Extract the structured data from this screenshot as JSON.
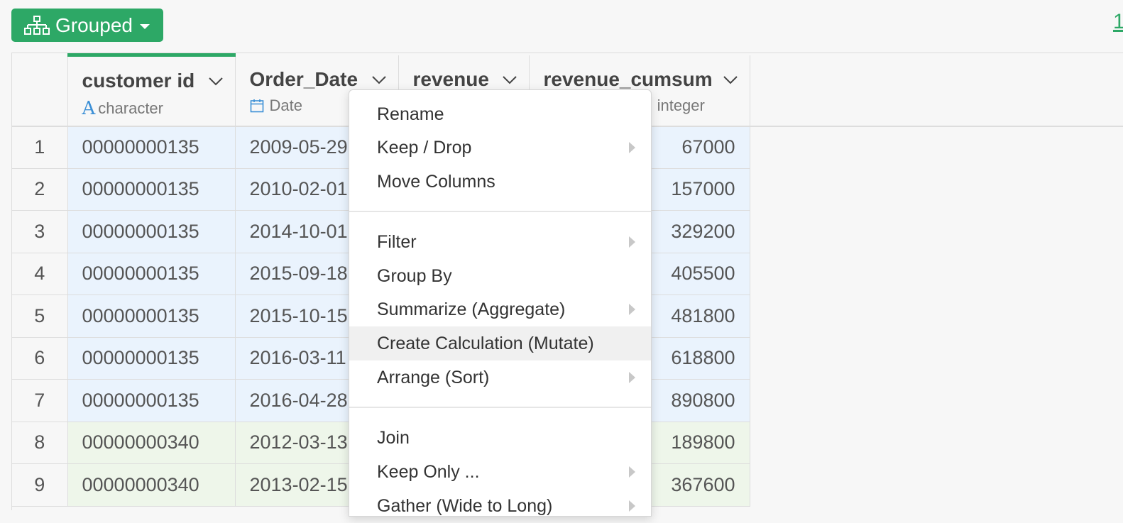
{
  "toolbar": {
    "grouped_label": "Grouped",
    "corner_link": "1"
  },
  "columns": [
    {
      "title": "customer id",
      "type": "character",
      "type_icon": "character-type-icon"
    },
    {
      "title": "Order_Date",
      "type": "Date",
      "type_icon": "calendar-icon"
    },
    {
      "title": "revenue",
      "type": "",
      "type_icon": ""
    },
    {
      "title": "revenue_cumsum",
      "type": "integer",
      "type_icon": "integer-type-icon"
    }
  ],
  "rows": [
    {
      "index": "1",
      "customer_id": "00000000135",
      "order_date": "2009-05-29",
      "revenue_cumsum": "67000",
      "group": 1
    },
    {
      "index": "2",
      "customer_id": "00000000135",
      "order_date": "2010-02-01",
      "revenue_cumsum": "157000",
      "group": 1
    },
    {
      "index": "3",
      "customer_id": "00000000135",
      "order_date": "2014-10-01",
      "revenue_cumsum": "329200",
      "group": 1
    },
    {
      "index": "4",
      "customer_id": "00000000135",
      "order_date": "2015-09-18",
      "revenue_cumsum": "405500",
      "group": 1
    },
    {
      "index": "5",
      "customer_id": "00000000135",
      "order_date": "2015-10-15",
      "revenue_cumsum": "481800",
      "group": 1
    },
    {
      "index": "6",
      "customer_id": "00000000135",
      "order_date": "2016-03-11",
      "revenue_cumsum": "618800",
      "group": 1
    },
    {
      "index": "7",
      "customer_id": "00000000135",
      "order_date": "2016-04-28",
      "revenue_cumsum": "890800",
      "group": 1
    },
    {
      "index": "8",
      "customer_id": "00000000340",
      "order_date": "2012-03-13",
      "revenue_cumsum": "189800",
      "group": 2
    },
    {
      "index": "9",
      "customer_id": "00000000340",
      "order_date": "2013-02-15",
      "revenue_cumsum": "367600",
      "group": 2
    }
  ],
  "context_menu": {
    "items": [
      {
        "label": "Rename",
        "submenu": false
      },
      {
        "label": "Keep / Drop",
        "submenu": true
      },
      {
        "label": "Move Columns",
        "submenu": false
      },
      {
        "label": "Filter",
        "submenu": true
      },
      {
        "label": "Group By",
        "submenu": false
      },
      {
        "label": "Summarize (Aggregate)",
        "submenu": true
      },
      {
        "label": "Create Calculation (Mutate)",
        "submenu": false,
        "highlighted": true
      },
      {
        "label": "Arrange (Sort)",
        "submenu": true
      },
      {
        "label": "Join",
        "submenu": false
      },
      {
        "label": "Keep Only ...",
        "submenu": true
      },
      {
        "label": "Gather (Wide to Long)",
        "submenu": true
      }
    ]
  },
  "colors": {
    "accent": "#2da866",
    "group1_bg": "#eaf3fd",
    "group2_bg": "#eef6ea",
    "type_char": "#3b8fd6"
  }
}
